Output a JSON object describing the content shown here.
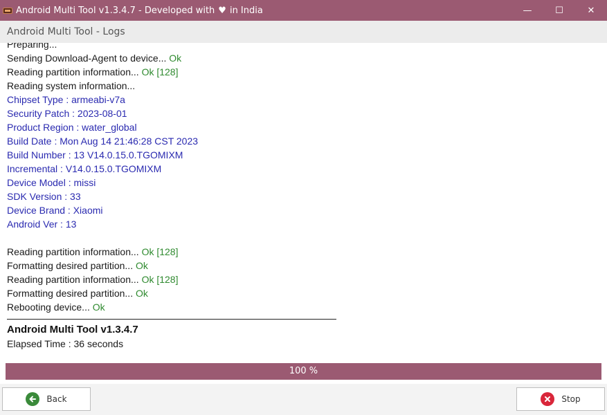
{
  "window": {
    "title_prefix": "Android Multi Tool v1.3.4.7 - Developed with",
    "title_suffix": "in India",
    "heart_icon": "heart-icon",
    "minimize": "—",
    "maximize": "☐",
    "close": "✕"
  },
  "header": {
    "title": "Android Multi Tool - Logs"
  },
  "logs": {
    "cut_line": "Preparing...",
    "lines": [
      {
        "text": "Sending Download-Agent to device...",
        "status": "Ok"
      },
      {
        "text": "Reading partition information...",
        "status": "Ok [128]"
      },
      {
        "text": "Reading system information...",
        "status": ""
      },
      {
        "text": "Chipset Type : armeabi-v7a"
      },
      {
        "text": "Security Patch : 2023-08-01"
      },
      {
        "text": "Product Region : water_global"
      },
      {
        "text": "Build Date : Mon Aug 14 21:46:28 CST 2023"
      },
      {
        "text": "Build Number : 13 V14.0.15.0.TGOMIXM"
      },
      {
        "text": "Incremental : V14.0.15.0.TGOMIXM"
      },
      {
        "text": "Device Model : missi"
      },
      {
        "text": "SDK Version : 33"
      },
      {
        "text": "Device Brand : Xiaomi"
      },
      {
        "text": "Android Ver : 13"
      },
      {
        "text": "Reading partition information...",
        "status": "Ok [128]"
      },
      {
        "text": "Formatting desired partition...",
        "status": "Ok"
      },
      {
        "text": "Reading partition information...",
        "status": "Ok [128]"
      },
      {
        "text": "Formatting desired partition...",
        "status": "Ok"
      },
      {
        "text": "Rebooting device...",
        "status": "Ok"
      }
    ],
    "footer_title": "Android Multi Tool v1.3.4.7",
    "elapsed": "Elapsed Time : 36 seconds"
  },
  "progress": {
    "label": "100 %",
    "value": 1.0,
    "color": "#9b5a72"
  },
  "buttons": {
    "back_label": "Back",
    "back_icon": "arrow-left-icon",
    "stop_label": "Stop",
    "stop_icon": "close-circle-icon"
  },
  "colors": {
    "accent": "#9b5a72",
    "ok": "#2f8a2f",
    "info": "#2a2ab0"
  }
}
